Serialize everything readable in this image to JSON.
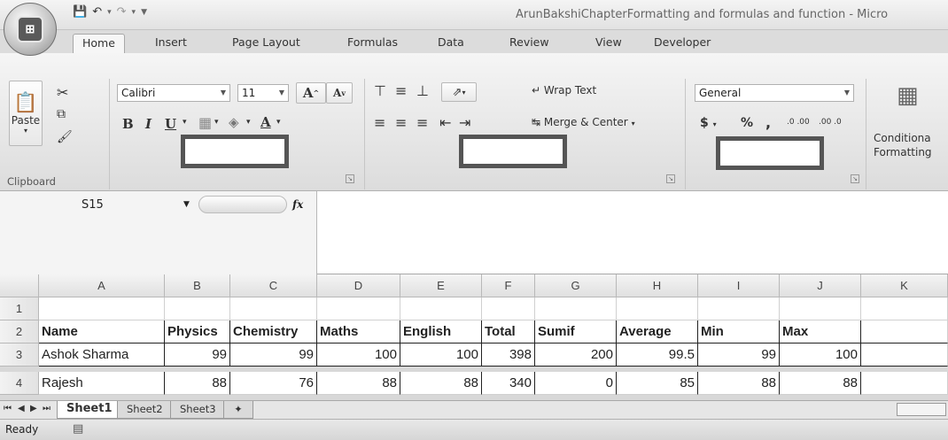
{
  "window": {
    "title": "ArunBakshiChapterFormatting and formulas and function - Micro",
    "office_logo": "⊞"
  },
  "ribbon_tabs": [
    "Home",
    "Insert",
    "Page Layout",
    "Formulas",
    "Data",
    "Review",
    "View",
    "Developer"
  ],
  "clipboard": {
    "paste_label": "Paste",
    "group_label": "Clipboard"
  },
  "font": {
    "name": "Calibri",
    "size": "11",
    "grow_label": "A",
    "shrink_label": "A",
    "bold": "B",
    "italic": "I",
    "underline": "U",
    "font_color": "A"
  },
  "alignment": {
    "wrap_text": "Wrap Text",
    "merge_center": "Merge & Center"
  },
  "number": {
    "format": "General",
    "currency": "$",
    "percent": "%",
    "comma": ",",
    "increase_decimal": ".0 .00",
    "decrease_decimal": ".00 .0"
  },
  "styles": {
    "conditional_formatting_line1": "Conditiona",
    "conditional_formatting_line2": "Formatting"
  },
  "formula_bar": {
    "name_box": "S15",
    "fx": "fx",
    "content": ""
  },
  "grid": {
    "column_headers": [
      "A",
      "B",
      "C",
      "D",
      "E",
      "F",
      "G",
      "H",
      "I",
      "J",
      "K"
    ],
    "row_headers": [
      "1",
      "2",
      "3",
      "4"
    ],
    "rows": [
      [
        "",
        "",
        "",
        "",
        "",
        "",
        "",
        "",
        "",
        "",
        ""
      ],
      [
        "Name",
        "Physics",
        "Chemistry",
        "Maths",
        "English",
        "Total",
        "Sumif",
        "Average",
        "Min",
        "Max",
        ""
      ],
      [
        "Ashok Sharma",
        "99",
        "99",
        "100",
        "100",
        "398",
        "200",
        "99.5",
        "99",
        "100",
        ""
      ],
      [
        "Rajesh",
        "88",
        "76",
        "88",
        "88",
        "340",
        "0",
        "85",
        "88",
        "88",
        ""
      ]
    ]
  },
  "sheets": [
    "Sheet1",
    "Sheet2",
    "Sheet3"
  ],
  "status": {
    "text": "Ready"
  }
}
